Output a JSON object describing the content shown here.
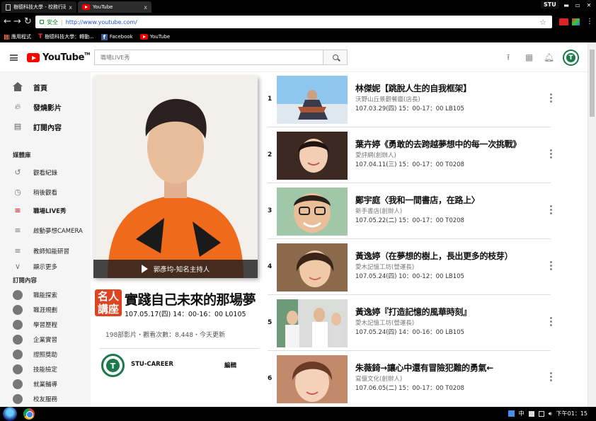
{
  "browser": {
    "tabs": [
      {
        "title": "樹德科技大學 - 校務行政"
      },
      {
        "title": "YouTube"
      }
    ],
    "profile": "STU",
    "omnibox": {
      "secure_label": "安全",
      "url": "http://www.youtube.com/"
    },
    "bookmarks": [
      {
        "label": "應用程式",
        "icon": "apps-grid-icon"
      },
      {
        "label": "樹德科技大學：轉動..."
      },
      {
        "label": "Facebook",
        "icon": "facebook-icon"
      },
      {
        "label": "YouTube",
        "icon": "youtube-icon"
      }
    ],
    "close_glyph": "x"
  },
  "masthead": {
    "logo_text": "YouTube",
    "logo_tm": "TM",
    "search_value": "職場LIVE秀",
    "avatar_letter": "T"
  },
  "sidebar": {
    "main": [
      {
        "label": "首頁",
        "icon": "home-icon"
      },
      {
        "label": "發燒影片",
        "icon": "fire-icon"
      },
      {
        "label": "訂閱內容",
        "icon": "subscriptions-icon"
      }
    ],
    "library_title": "媒體庫",
    "library": [
      {
        "label": "觀看紀錄",
        "icon": "history-icon"
      },
      {
        "label": "稍後觀看",
        "icon": "clock-icon"
      },
      {
        "label": "職場LIVE秀",
        "icon": "playlist-icon"
      },
      {
        "label": "啟動夢想CAMERA",
        "icon": "playlist-icon"
      },
      {
        "label": "教師知能研習",
        "icon": "playlist-icon"
      },
      {
        "label": "顯示更多",
        "icon": "chevron-down-icon"
      }
    ],
    "subs_title": "訂閱內容",
    "subs": [
      {
        "label": "職能探索"
      },
      {
        "label": "職涯規劃"
      },
      {
        "label": "學習歷程"
      },
      {
        "label": "企業實習"
      },
      {
        "label": "證照獎助"
      },
      {
        "label": "技能檢定"
      },
      {
        "label": "就業輔導"
      },
      {
        "label": "校友服務"
      }
    ]
  },
  "playlist": {
    "hero_caption": "郭彥均-知名主持人",
    "badge": "名人講座",
    "title": "實踐自己未來的那場夢",
    "date": "107.05.17(四) 14：00-16：00  L0105",
    "stats": "198部影片・觀看次數：8,448・今天更新",
    "owner": "STU-CAREER",
    "edit_label": "編輯"
  },
  "videos": [
    {
      "index": "1",
      "title": "林傑妮【跳脫人生的自我框架】",
      "channel": "沃野山丘景觀餐廳(店長)",
      "date": "107.03.29(四)  15：00-17：00  LB105"
    },
    {
      "index": "2",
      "title": "葉卉婷《勇敢的去跨越夢想中的每一次挑戰》",
      "channel": "愛評網(創辦人)",
      "date": "107.04.11(三)  15：00-17：00  T0208"
    },
    {
      "index": "3",
      "title": "鄭宇庭〈我和一間書店，在路上〉",
      "channel": "新手書店(創辦人)",
      "date": "107.05.22(二)  15：00-17：00  T0208"
    },
    {
      "index": "4",
      "title": "黃逸婷（在夢想的樹上，長出更多的枝芽）",
      "channel": "愛木記憶工坊(營運長)",
      "date": "107.05.24(四)  10：00-12：00  LB105"
    },
    {
      "index": "5",
      "title": "黃逸婷『打造記憶的風華時刻』",
      "channel": "愛木記憶工坊(營運長)",
      "date": "107.05.24(四)  14：00-16：00  LB105"
    },
    {
      "index": "6",
      "title": "朱薇錡→讓心中還有冒險犯難的勇氣←",
      "channel": "寫億文化(創辦人)",
      "date": "107.06.05(二)  15：00-17：00  T0208"
    }
  ],
  "taskbar": {
    "ime": "中",
    "clock": "下午01：15"
  }
}
